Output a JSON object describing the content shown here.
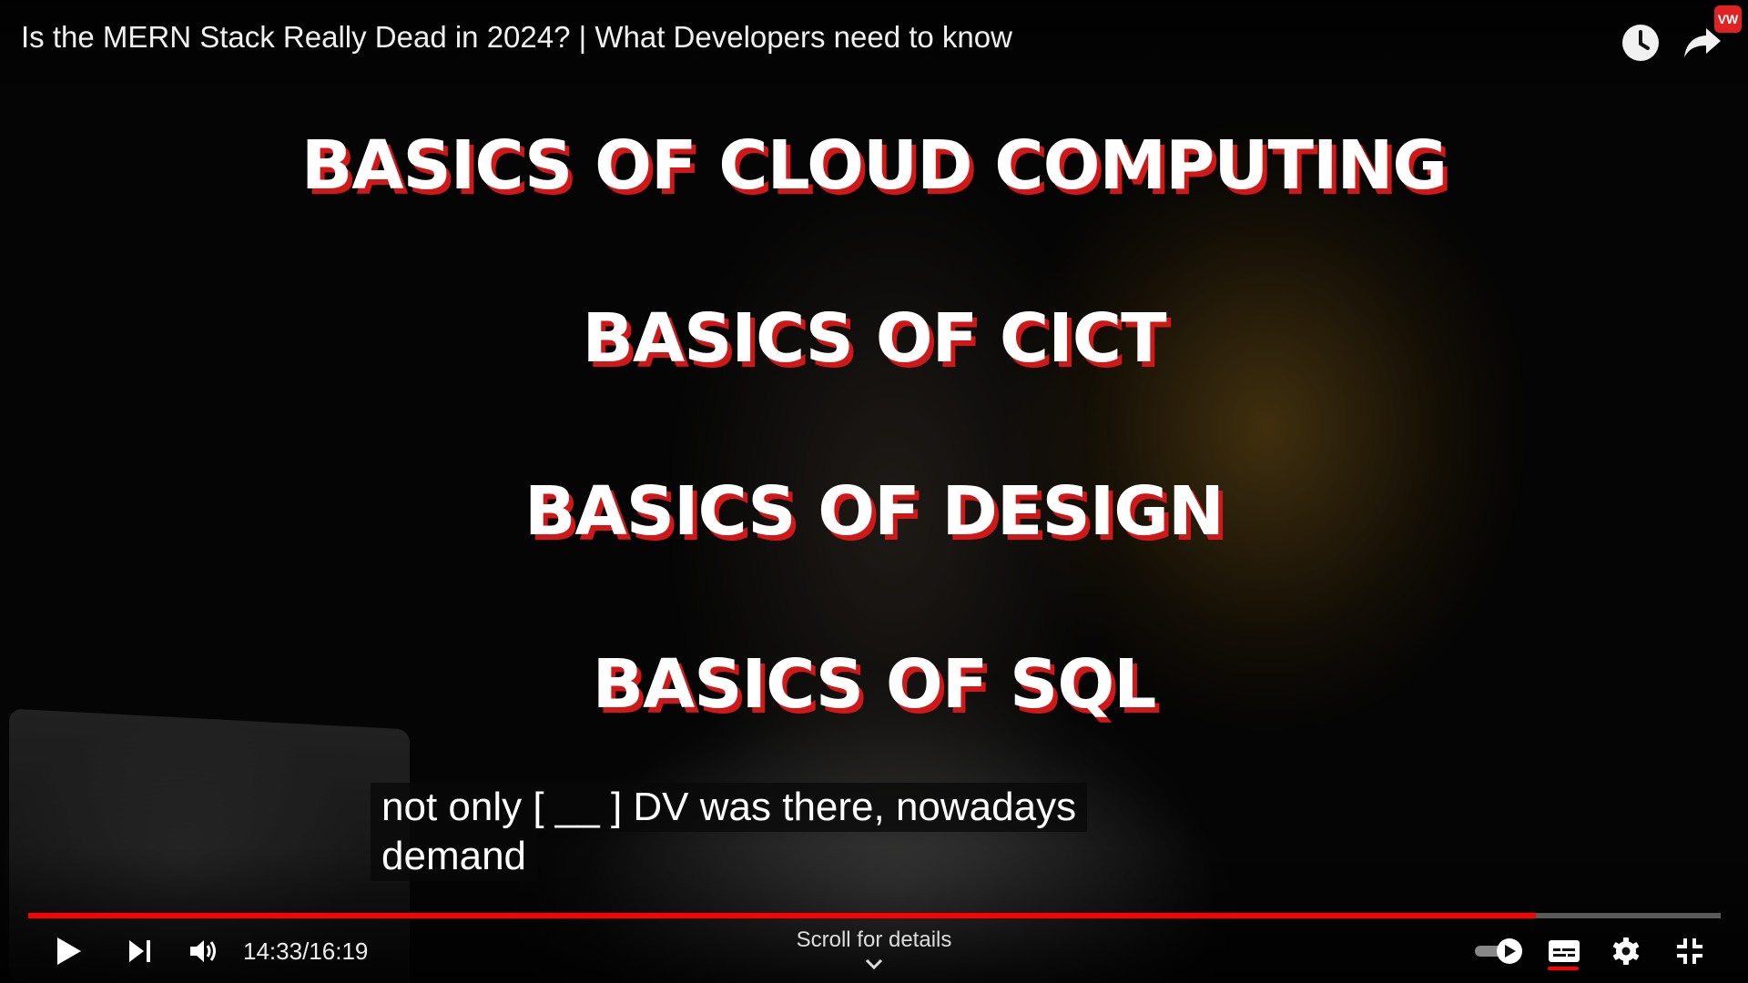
{
  "video": {
    "title": "Is the MERN Stack Really Dead in 2024? | What Developers need to know"
  },
  "overlay": {
    "headlines": [
      "BASICS OF CLOUD COMPUTING",
      "BASICS OF CICT",
      "BASICS OF DESIGN",
      "BASICS OF SQL"
    ]
  },
  "captions": {
    "line1": "not only [ __ ] DV was there, nowadays",
    "line2": "demand"
  },
  "top_actions": {
    "watch_later_icon": "clock-icon",
    "share_icon": "share-arrow-icon",
    "extension_badge": "VW"
  },
  "player": {
    "current_time": "14:33",
    "separator": " / ",
    "duration": "16:19",
    "progress_fraction": 0.8906,
    "scroll_hint": "Scroll for details",
    "accent_color": "#ff0000",
    "autoplay_on": true,
    "captions_on": true
  }
}
